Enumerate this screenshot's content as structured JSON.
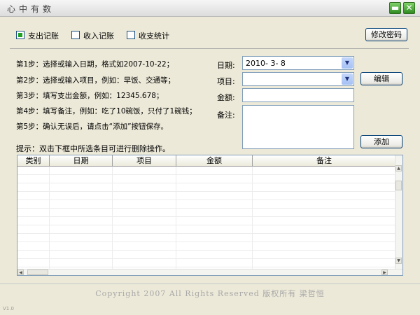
{
  "window": {
    "title": "心中有数",
    "minimize": "▬",
    "close": "✕"
  },
  "modes": [
    {
      "label": "支出记账",
      "checked": true
    },
    {
      "label": "收入记账",
      "checked": false
    },
    {
      "label": "收支统计",
      "checked": false
    }
  ],
  "change_password_label": "修改密码",
  "steps": [
    "第1步：选择或输入日期，格式如2007-10-22；",
    "第2步：选择或输入项目，例如：早饭、交通等；",
    "第3步：填写支出金额，例如：12345.678；",
    "第4步：填写备注，例如：吃了10碗饭，只付了1碗钱；",
    "第5步：确认无误后，请点击“添加”按钮保存。"
  ],
  "form": {
    "date_label": "日期:",
    "date_value": "2010- 3- 8",
    "item_label": "项目:",
    "item_value": "",
    "amount_label": "金额:",
    "amount_value": "",
    "note_label": "备注:",
    "note_value": ""
  },
  "edit_label": "编辑",
  "add_label": "添加",
  "hint": "提示：双击下框中所选条目可进行删除操作。",
  "table": {
    "columns": [
      "类别",
      "日期",
      "项目",
      "金额",
      "备注"
    ],
    "rows": []
  },
  "footer": "Copyright 2007  All Rights Reserved  版权所有 梁哲恒",
  "version": "V1.0"
}
